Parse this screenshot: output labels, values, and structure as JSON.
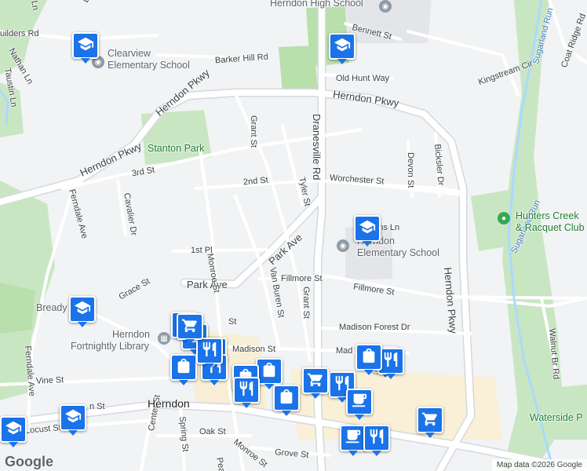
{
  "map": {
    "attribution": "Map data ©2026 Google",
    "logo": "Google",
    "colors": {
      "road": "#ffffff",
      "park": "#c9e6c2",
      "school_grounds": "#e8eaed",
      "commercial": "#faf0d7",
      "pin": "#1a73e8",
      "water": "#aadaff"
    }
  },
  "streets": {
    "herndon_pkwy_north": "Herndon Pkwy",
    "herndon_pkwy_north2": "Herndon Pkwy",
    "herndon_pkwy_west": "Herndon Pkwy",
    "herndon_pkwy_east": "Herndon Pkwy",
    "dranesville_rd": "Dranesville Rd",
    "park_ave_diag": "Park Ave",
    "park_ave_west": "Park Ave",
    "grant_st_north": "Grant St",
    "grant_st_south": "Grant St",
    "tyler_st": "Tyler St",
    "second_st": "2nd St",
    "third_st": "3rd St",
    "first_pl": "1st Pl",
    "monroe_st": "Monroe St",
    "monroe_st_south": "Monroe St",
    "van_buren_st": "Van Buren St",
    "fillmore_st_west": "Fillmore St",
    "fillmore_st_east": "Fillmore St",
    "madison_forest_dr": "Madison Forest Dr",
    "madison_st": "Madison St",
    "madison_st_east": "Madison St",
    "worchester_st": "Worchester St",
    "devon_st": "Devon St",
    "bicksler_dr": "Bicksler Dr",
    "barker_hill_rd": "Barker Hill Rd",
    "bennett_st": "Bennett St",
    "old_hunt_way": "Old Hunt Way",
    "kingstream_cir": "Kingstream Cir",
    "coat_ridge_rd": "Coat Ridge Rd",
    "sugarland_run_north": "Sugarland Run",
    "sugarland_run_mid": "Sugarland Run",
    "walnut_br_rd": "Walnut Br Rd",
    "ferndale_ave_north": "Ferndale Ave",
    "ferndale_ave_south": "Ferndale Ave",
    "cavalier_dr": "Cavalier Dr",
    "grace_st": "Grace St",
    "vine_st": "Vine St",
    "locust_st": "Locust St",
    "center_st": "Center St",
    "spring_st": "Spring St",
    "oak_st": "Oak St",
    "grove_st": "Grove St",
    "elden_st": "n St",
    "nathan_ln": "Nathan Ln",
    "taustin_ln": "Taustin Ln",
    "builders_rd": "uilders Rd",
    "mercer_ln": "M  ns Ln",
    "top_dr": "Dr",
    "top_ln": "Ln",
    "pearl_st": "Pearl",
    "st_fragment": "St",
    "madison_fragment": "Mad"
  },
  "places": {
    "herndon_high_school": "Herndon High School",
    "clearview_line1": "Clearview",
    "clearview_line2": "Elementary School",
    "stanton_park": "Stanton Park",
    "herndon_elem_line1": "Herndon",
    "herndon_elem_line2": "Elementary School",
    "hunters_creek_line1": "Hunters Creek",
    "hunters_creek_line2": "& Racquet Club",
    "library_line1": "Herndon",
    "library_line2": "Fortnightly Library",
    "bready": "Bready",
    "herndon_town": "Herndon",
    "waterside": "Waterside P"
  },
  "pins": [
    {
      "name": "school-pin-clearview",
      "icon": "graduation-cap-icon",
      "glyph": "cap"
    },
    {
      "name": "school-pin-high-school",
      "icon": "graduation-cap-icon",
      "glyph": "cap"
    },
    {
      "name": "school-pin-herndon-elem",
      "icon": "graduation-cap-icon",
      "glyph": "cap"
    },
    {
      "name": "school-pin-bready",
      "icon": "graduation-cap-icon",
      "glyph": "cap"
    },
    {
      "name": "school-pin-southwest",
      "icon": "graduation-cap-icon",
      "glyph": "cap"
    },
    {
      "name": "school-pin-edge",
      "icon": "graduation-cap-icon",
      "glyph": "cap"
    },
    {
      "name": "shopping-bag-pin-1",
      "icon": "shopping-bag-icon",
      "glyph": "bag"
    },
    {
      "name": "shopping-bag-pin-2",
      "icon": "shopping-bag-icon",
      "glyph": "bag"
    },
    {
      "name": "shopping-bag-pin-3",
      "icon": "shopping-bag-icon",
      "glyph": "bag"
    },
    {
      "name": "shopping-bag-pin-4",
      "icon": "shopping-bag-icon",
      "glyph": "bag"
    },
    {
      "name": "shopping-bag-pin-5",
      "icon": "shopping-bag-icon",
      "glyph": "bag"
    },
    {
      "name": "shopping-bag-pin-6",
      "icon": "shopping-bag-icon",
      "glyph": "bag"
    },
    {
      "name": "restaurant-pin-1",
      "icon": "fork-knife-icon",
      "glyph": "fork"
    },
    {
      "name": "restaurant-pin-2",
      "icon": "fork-knife-icon",
      "glyph": "fork"
    },
    {
      "name": "restaurant-pin-3",
      "icon": "fork-knife-icon",
      "glyph": "fork"
    },
    {
      "name": "restaurant-pin-4",
      "icon": "fork-knife-icon",
      "glyph": "fork"
    },
    {
      "name": "restaurant-pin-5",
      "icon": "fork-knife-icon",
      "glyph": "fork"
    },
    {
      "name": "restaurant-pin-6",
      "icon": "fork-knife-icon",
      "glyph": "fork"
    },
    {
      "name": "grocery-pin-1",
      "icon": "shopping-cart-icon",
      "glyph": "cart"
    },
    {
      "name": "grocery-pin-2",
      "icon": "shopping-cart-icon",
      "glyph": "cart"
    },
    {
      "name": "grocery-pin-3",
      "icon": "shopping-cart-icon",
      "glyph": "cart"
    },
    {
      "name": "grocery-pin-4",
      "icon": "shopping-cart-icon",
      "glyph": "cart"
    },
    {
      "name": "cafe-pin-1",
      "icon": "coffee-cup-icon",
      "glyph": "cup"
    },
    {
      "name": "cafe-pin-2",
      "icon": "coffee-cup-icon",
      "glyph": "cup"
    },
    {
      "name": "restaurant-pin-7",
      "icon": "fork-knife-icon",
      "glyph": "fork"
    },
    {
      "name": "shopping-bag-pin-7",
      "icon": "shopping-bag-icon",
      "glyph": "bag"
    }
  ]
}
